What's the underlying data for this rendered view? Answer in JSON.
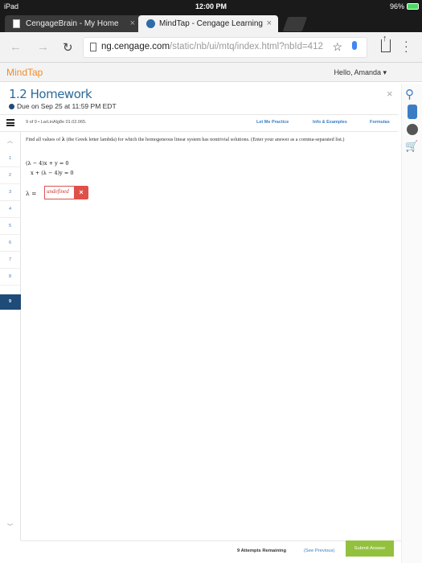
{
  "status_bar": {
    "device": "iPad",
    "time": "12:00 PM",
    "battery": "96%"
  },
  "tabs": [
    {
      "label": "CengageBrain - My Home",
      "close": "×"
    },
    {
      "label": "MindTap - Cengage Learning",
      "close": "×"
    }
  ],
  "address_bar": {
    "url_main": "ng.cengage.com",
    "url_rest": "/static/nb/ui/mtq/index.html?nbId=412"
  },
  "app": {
    "logo": "MindTap",
    "greeting": "Hello, Amanda ▾"
  },
  "assignment": {
    "title": "1.2 Homework",
    "due": "Due on Sep 25 at 11:59 PM EDT",
    "close": "×"
  },
  "question_bar": {
    "meta": "9 of 9 • LarLinAlg8e 01.02.065.",
    "links": [
      "Let Me Practice",
      "Info & Examples",
      "Formulas"
    ]
  },
  "question_nav": [
    "1",
    "2",
    "3",
    "4",
    "5",
    "6",
    "7",
    "8",
    "9"
  ],
  "question": {
    "prompt_before": "Find all values of ",
    "lambda": "λ",
    "prompt_after": " (the Greek letter lambda) for which the homogeneous linear system has nontrivial solutions. (Enter your answer as a comma-separated list.)",
    "eq1": "(λ − 4)x  +          y  =  0",
    "eq2": "x  +  (λ − 4)y  =  0",
    "answer_label": "λ =",
    "answer_value": "undefined",
    "answer_clear": "×"
  },
  "footer": {
    "attempts": "9 Attempts Remaining",
    "see_previous": "(See Previous)",
    "submit": "Submit Answer"
  },
  "colors": {
    "brand": "#f08c2e",
    "title": "#2a6a9c",
    "active_nav": "#1e4b78",
    "submit": "#93c13e",
    "error": "#e0504a"
  }
}
